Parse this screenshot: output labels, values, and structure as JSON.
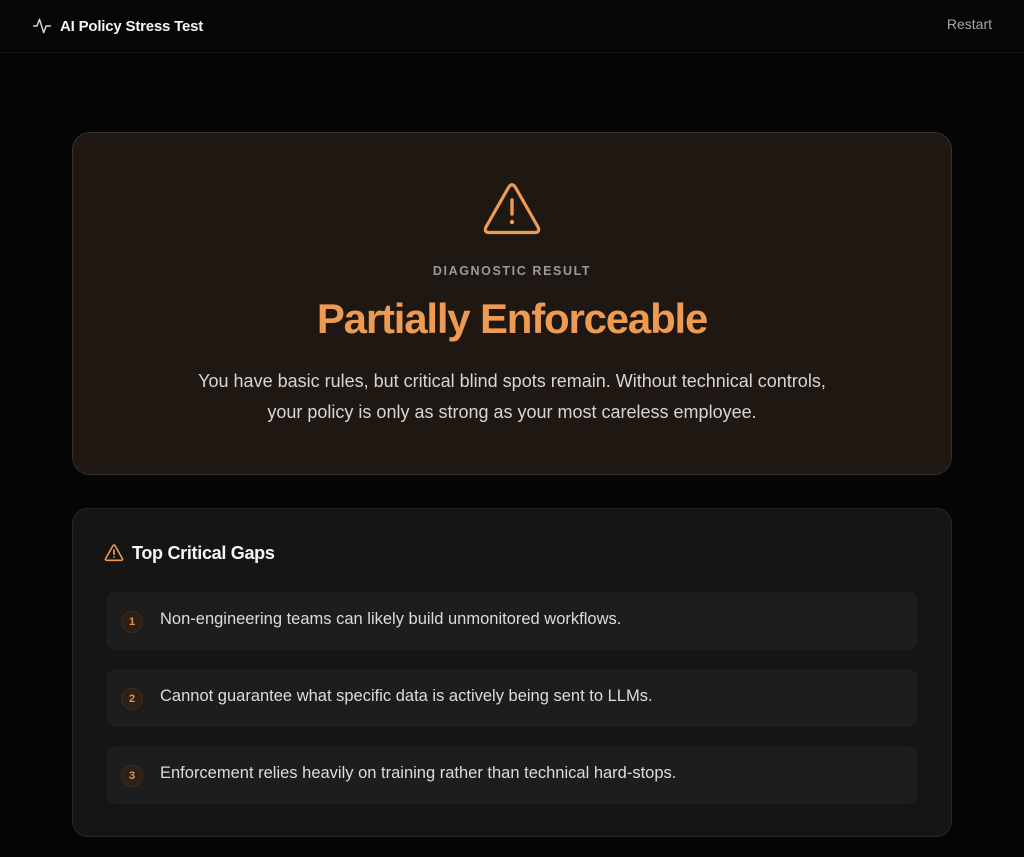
{
  "header": {
    "app_title": "AI Policy Stress Test",
    "restart_label": "Restart",
    "brand_icon": "activity-pulse-icon"
  },
  "result": {
    "icon": "warning-triangle-icon",
    "kicker": "DIAGNOSTIC RESULT",
    "title": "Partially Enforceable",
    "description": "You have basic rules, but critical blind spots remain. Without technical controls, your policy is only as strong as your most careless employee."
  },
  "gaps": {
    "icon": "warning-triangle-icon",
    "title": "Top Critical Gaps",
    "items": [
      {
        "number": "1",
        "text": "Non-engineering teams can likely build unmonitored workflows."
      },
      {
        "number": "2",
        "text": "Cannot guarantee what specific data is actively being sent to LLMs."
      },
      {
        "number": "3",
        "text": "Enforcement relies heavily on training rather than technical hard-stops."
      }
    ]
  },
  "colors": {
    "accent": "#ee9a52",
    "background": "#050505",
    "result_card": "#1e1712",
    "gaps_card": "#151515"
  }
}
